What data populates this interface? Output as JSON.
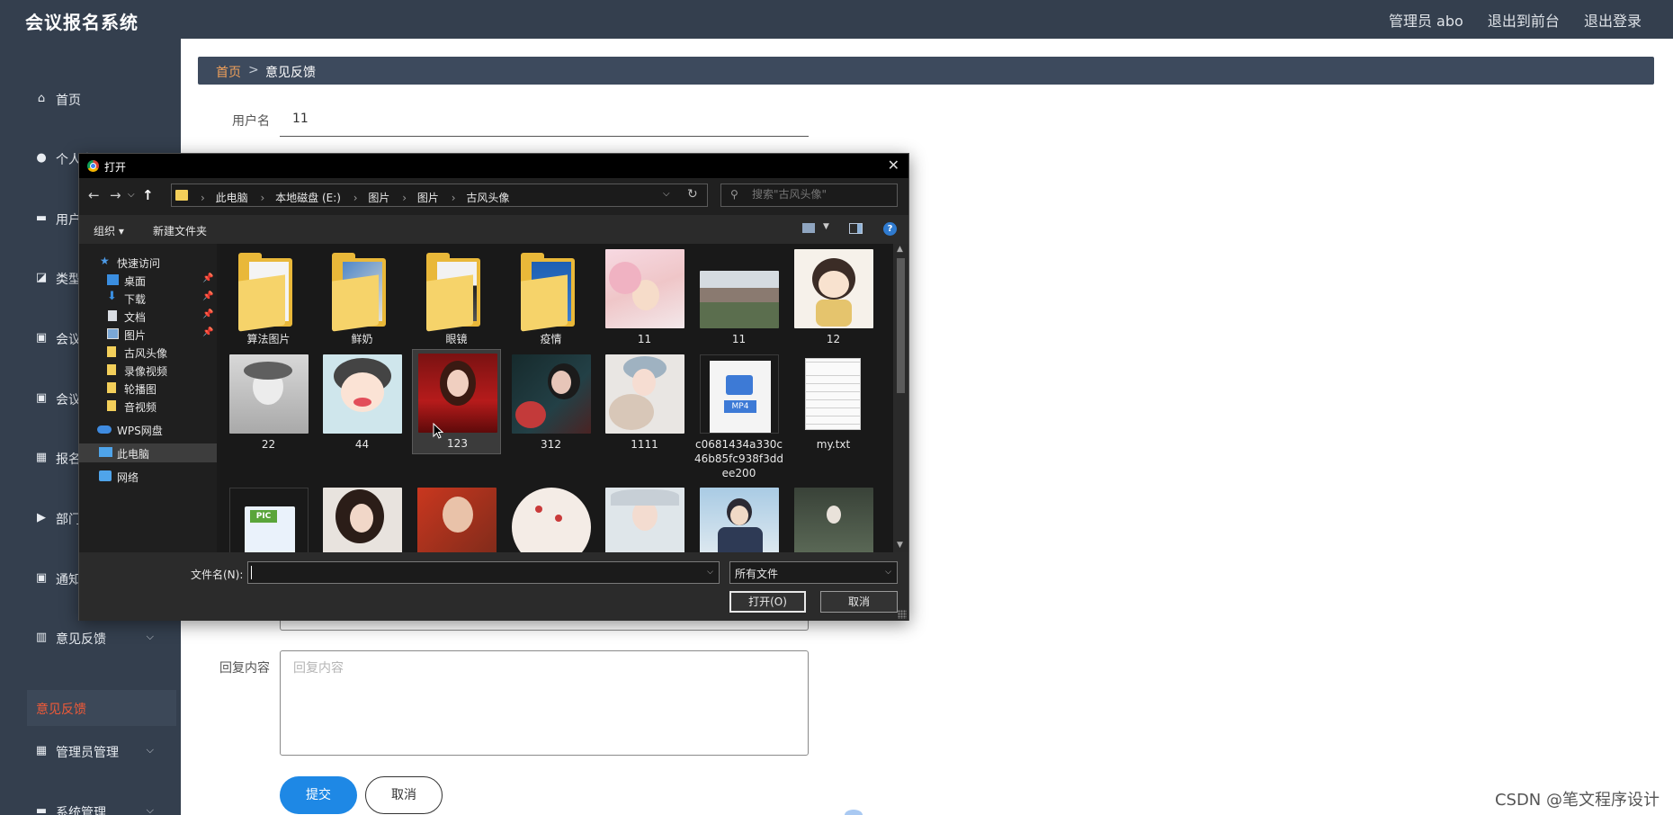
{
  "app": {
    "title": "会议报名系统"
  },
  "header": {
    "admin_label": "管理员 abo",
    "to_front": "退出到前台",
    "logout": "退出登录"
  },
  "sidebar": {
    "items": [
      {
        "label": "首页",
        "icon": "home-icon",
        "expandable": false
      },
      {
        "label": "个人中心",
        "icon": "user-icon",
        "expandable": true
      },
      {
        "label": "用户",
        "icon": "users-icon",
        "expandable": true
      },
      {
        "label": "类型",
        "icon": "chart-icon",
        "expandable": true
      },
      {
        "label": "会议",
        "icon": "clipboard-icon",
        "expandable": true
      },
      {
        "label": "会议",
        "icon": "clipboard-icon",
        "expandable": true
      },
      {
        "label": "报名",
        "icon": "grid-icon",
        "expandable": true
      },
      {
        "label": "部门",
        "icon": "video-icon",
        "expandable": true
      },
      {
        "label": "通知",
        "icon": "clipboard-icon",
        "expandable": true
      },
      {
        "label": "意见反馈",
        "icon": "bar-chart-icon",
        "expandable": true
      },
      {
        "label": "管理员管理",
        "icon": "grid-icon",
        "expandable": true
      },
      {
        "label": "系统管理",
        "icon": "monitor-icon",
        "expandable": true
      }
    ],
    "active_sub": "意见反馈"
  },
  "breadcrumb": {
    "home": "首页",
    "separator": ">",
    "current": "意见反馈"
  },
  "form": {
    "username_label": "用户名",
    "username_value": "11",
    "reply_label": "回复内容",
    "reply_placeholder": "回复内容",
    "submit": "提交",
    "cancel": "取消"
  },
  "dialog": {
    "title": "打开",
    "breadcrumbs": [
      "此电脑",
      "本地磁盘 (E:)",
      "图片",
      "图片",
      "古风头像"
    ],
    "search_placeholder": "搜索\"古风头像\"",
    "organize": "组织 ▾",
    "new_folder": "新建文件夹",
    "help": "?",
    "nav": [
      {
        "label": "快速访问",
        "icon": "star-icon",
        "level": 0,
        "pinned": false
      },
      {
        "label": "桌面",
        "icon": "desktop-icon",
        "level": 1,
        "pinned": true
      },
      {
        "label": "下载",
        "icon": "download-icon",
        "level": 1,
        "pinned": true
      },
      {
        "label": "文档",
        "icon": "document-icon",
        "level": 1,
        "pinned": true
      },
      {
        "label": "图片",
        "icon": "pictures-icon",
        "level": 1,
        "pinned": true
      },
      {
        "label": "古风头像",
        "icon": "folder-icon",
        "level": 1,
        "pinned": false
      },
      {
        "label": "录像视频",
        "icon": "folder-icon",
        "level": 1,
        "pinned": false
      },
      {
        "label": "轮播图",
        "icon": "folder-icon",
        "level": 1,
        "pinned": false
      },
      {
        "label": "音视频",
        "icon": "folder-icon",
        "level": 1,
        "pinned": false
      },
      {
        "label": "WPS网盘",
        "icon": "cloud-icon",
        "level": 0,
        "pinned": false
      },
      {
        "label": "此电脑",
        "icon": "computer-icon",
        "level": 0,
        "pinned": false,
        "selected": true
      },
      {
        "label": "网络",
        "icon": "network-icon",
        "level": 0,
        "pinned": false
      }
    ],
    "files": [
      {
        "name": "算法图片",
        "kind": "folder"
      },
      {
        "name": "鲜奶",
        "kind": "folder"
      },
      {
        "name": "眼镜",
        "kind": "folder"
      },
      {
        "name": "疫情",
        "kind": "folder"
      },
      {
        "name": "11",
        "kind": "image"
      },
      {
        "name": "11",
        "kind": "image"
      },
      {
        "name": "12",
        "kind": "image"
      },
      {
        "name": "22",
        "kind": "image"
      },
      {
        "name": "44",
        "kind": "image"
      },
      {
        "name": "123",
        "kind": "image",
        "selected": true
      },
      {
        "name": "312",
        "kind": "image"
      },
      {
        "name": "1111",
        "kind": "image"
      },
      {
        "name": "c0681434a330c46b85fc938f3ddee200",
        "kind": "mp4"
      },
      {
        "name": "my.txt",
        "kind": "txt"
      },
      {
        "name": "",
        "kind": "pic"
      },
      {
        "name": "",
        "kind": "image"
      },
      {
        "name": "",
        "kind": "image"
      },
      {
        "name": "",
        "kind": "image"
      },
      {
        "name": "",
        "kind": "image"
      },
      {
        "name": "",
        "kind": "image"
      },
      {
        "name": "",
        "kind": "image"
      }
    ],
    "filename_label": "文件名(N):",
    "filename_value": "",
    "filetype": "所有文件",
    "open_button": "打开(O)",
    "cancel_button": "取消",
    "mp4_badge": "MP4",
    "pic_badge": "PIC"
  },
  "watermark": "CSDN @笔文程序设计",
  "colors": {
    "sidebar_bg": "#343f4e",
    "accent_orange": "#f05a38",
    "primary_blue": "#1e88e5",
    "dialog_bg": "#202020"
  }
}
